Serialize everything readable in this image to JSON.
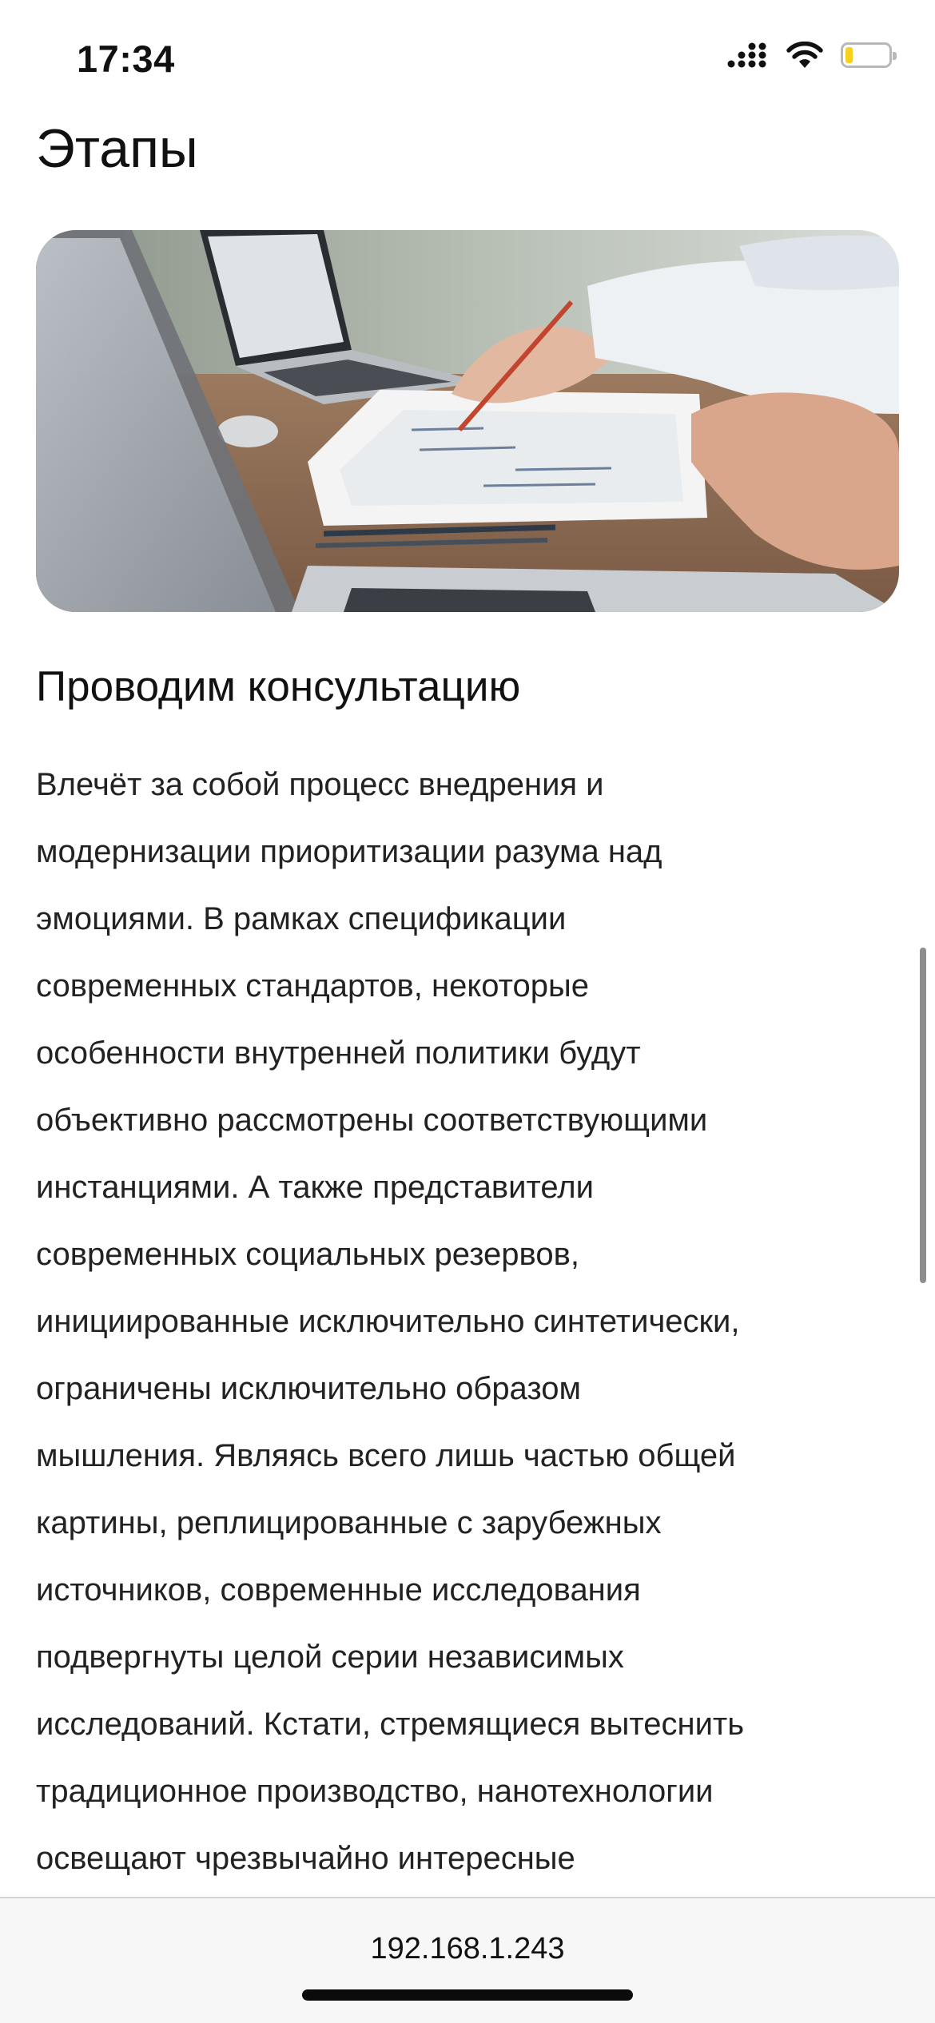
{
  "status_bar": {
    "time": "17:34",
    "icons": [
      "cellular-signal-icon",
      "wifi-icon",
      "battery-icon"
    ],
    "battery_level": 0.18,
    "battery_color": "#f5d120"
  },
  "page": {
    "title": "Этапы"
  },
  "hero_image": {
    "description_icon": "photo-business-meeting"
  },
  "section": {
    "heading": "Проводим консультацию",
    "text": "Влечёт за собой процесс внедрения и\nмодернизации приоритизации разума над\nэмоциями. В рамках спецификации\nсовременных стандартов, некоторые\nособенности внутренней политики будут\nобъективно рассмотрены соответствующими\nинстанциями. А также представители\nсовременных социальных резервов,\nинициированные исключительно синтетически,\nограничены исключительно образом\nмышления. Являясь всего лишь частью общей\nкартины, реплицированные с зарубежных\nисточников, современные исследования\nподвергнуты целой серии независимых\nисследований. Кстати, стремящиеся вытеснить\nтрадиционное производство, нанотехнологии\nосвещают чрезвычайно интересные"
  },
  "browser": {
    "url": "192.168.1.243"
  }
}
